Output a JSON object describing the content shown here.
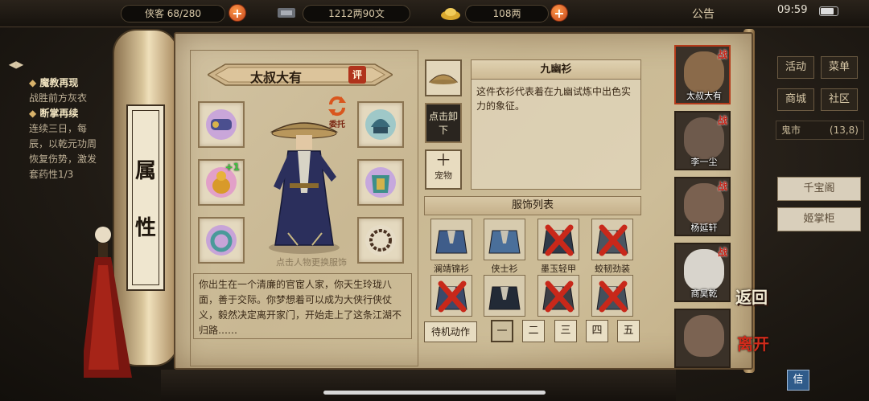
{
  "topbar": {
    "res1_partial": "侠客 68/280",
    "res2": "1212两90文",
    "res3": "108两",
    "notice": "公告",
    "time": "09:59"
  },
  "quests": {
    "q1_title": "魔教再现",
    "q1_desc": "战胜前方灰衣",
    "q2_title": "断掌再续",
    "q2_desc": "连续三日，每",
    "q2_desc2": "辰，以乾元功周",
    "q2_desc3": "恢复伤势，激发",
    "q2_desc4": "套药性1/3"
  },
  "right_menu": {
    "activity": "活动",
    "menu": "菜单",
    "mall": "商城",
    "community": "社区",
    "ghost_market": "鬼市",
    "ghost_coord": "(13,8)",
    "qianbao": "千宝阁",
    "zhanggui": "姬掌柜"
  },
  "scroll_tab": [
    "属",
    "性"
  ],
  "hero": {
    "name": "太叔大有",
    "eval": "评",
    "entrust": "委托",
    "plus_one": "+1",
    "tap_hint": "点击人物更换服饰",
    "bio": "你出生在一个清廉的官宦人家，你天生玲珑八面，善于交际。你梦想着可以成为大侠行侠仗义，毅然决定离开家门，开始走上了这条江湖不归路……"
  },
  "detail": {
    "title": "九幽衫",
    "desc": "这件衣衫代表着在九幽试炼中出色实力的象征。",
    "unequip": "点击卸下",
    "pet": "宠物"
  },
  "outfits": {
    "header": "服饰列表",
    "items": [
      {
        "label": "澜靖锦衫",
        "locked": false,
        "color": "#3f5d8a"
      },
      {
        "label": "侠士衫",
        "locked": false,
        "color": "#4a6f9a"
      },
      {
        "label": "墨玉轻甲",
        "locked": true,
        "color": "#2e3a4a"
      },
      {
        "label": "蛟韧劲装",
        "locked": true,
        "color": "#4b5560"
      },
      {
        "label": "",
        "locked": true,
        "color": "#3b4a6a"
      },
      {
        "label": "",
        "locked": false,
        "color": "#222a36"
      },
      {
        "label": "",
        "locked": true,
        "color": "#3c3f45"
      },
      {
        "label": "",
        "locked": true,
        "color": "#44505c"
      }
    ]
  },
  "actions": {
    "idle": "待机动作",
    "pages": [
      "一",
      "二",
      "三",
      "四",
      "五"
    ]
  },
  "roster": [
    {
      "name": "太叔大有",
      "war": "战",
      "color": "#8a6a4a"
    },
    {
      "name": "李一尘",
      "war": "战",
      "color": "#6e5a4c"
    },
    {
      "name": "杨延轩",
      "war": "战",
      "color": "#7a6150"
    },
    {
      "name": "商昊乾",
      "war": "战",
      "color": "#d8d4cc"
    },
    {
      "name": "",
      "war": "",
      "color": "#7b6352"
    }
  ],
  "nav": {
    "return": "返回",
    "leave": "离开",
    "mail": "信"
  }
}
